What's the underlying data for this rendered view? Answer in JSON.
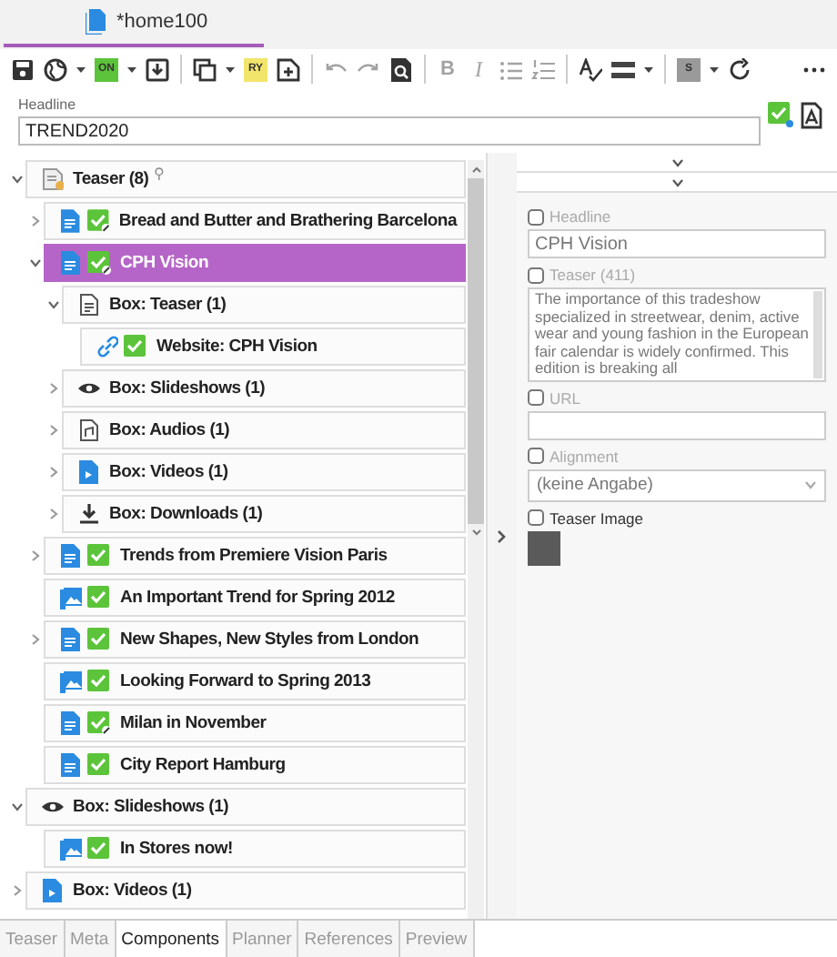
{
  "document_tab": {
    "title": "*home100",
    "selected": true
  },
  "toolbar": [
    {
      "kind": "save"
    },
    {
      "kind": "globe",
      "caret": true
    },
    {
      "kind": "badge",
      "label": "ON",
      "color": "#5cc43a",
      "caret": true
    },
    {
      "kind": "import"
    },
    {
      "kind": "separator"
    },
    {
      "kind": "copy",
      "caret": true
    },
    {
      "kind": "badge",
      "label": "RY",
      "color": "#f2e56b"
    },
    {
      "kind": "add-doc"
    },
    {
      "kind": "separator"
    },
    {
      "kind": "undo",
      "disabled": true
    },
    {
      "kind": "redo",
      "disabled": true
    },
    {
      "kind": "preview"
    },
    {
      "kind": "separator"
    },
    {
      "kind": "text",
      "label": "B",
      "disabled": true
    },
    {
      "kind": "text",
      "label": "I",
      "disabled": true,
      "italic": true
    },
    {
      "kind": "bullets",
      "disabled": true
    },
    {
      "kind": "numbers",
      "disabled": true
    },
    {
      "kind": "separator"
    },
    {
      "kind": "spell"
    },
    {
      "kind": "rule",
      "caret": true
    },
    {
      "kind": "separator"
    },
    {
      "kind": "badge",
      "label": "S",
      "color": "#9a9a9a",
      "caret": true
    },
    {
      "kind": "refresh"
    },
    {
      "kind": "more"
    }
  ],
  "headline": {
    "label": "Headline",
    "value": "TREND2020"
  },
  "tree": [
    {
      "label": "Teaser (8)",
      "kind": "teaser",
      "pin": "⚲",
      "expanded": true,
      "selected": false,
      "children": [
        {
          "label": "Bread and Butter and Brathering Barcelona",
          "kind": "article",
          "approved": true,
          "edited": true,
          "expanded": false,
          "selected": false
        },
        {
          "label": "CPH Vision",
          "kind": "article",
          "approved": true,
          "edited": true,
          "expanded": true,
          "selected": true,
          "children": [
            {
              "label": "Box: Teaser (1)",
              "kind": "box",
              "expanded": true,
              "selected": false,
              "children": [
                {
                  "label": "Website: CPH Vision",
                  "kind": "link",
                  "approved": true,
                  "edited": false,
                  "selected": false
                }
              ]
            },
            {
              "label": "Box: Slideshows (1)",
              "kind": "slideshow",
              "expanded": false,
              "selected": false
            },
            {
              "label": "Box: Audios (1)",
              "kind": "audio",
              "expanded": false,
              "selected": false
            },
            {
              "label": "Box: Videos (1)",
              "kind": "video",
              "expanded": false,
              "selected": false
            },
            {
              "label": "Box: Downloads (1)",
              "kind": "download",
              "expanded": false,
              "selected": false
            }
          ]
        },
        {
          "label": "Trends from Premiere Vision Paris",
          "kind": "article",
          "approved": true,
          "edited": false,
          "expanded": false,
          "selected": false
        },
        {
          "label": "An Important Trend for Spring 2012",
          "kind": "gallery",
          "approved": true,
          "edited": false,
          "selected": false
        },
        {
          "label": "New Shapes, New Styles from London",
          "kind": "article",
          "approved": true,
          "edited": false,
          "expanded": false,
          "selected": false
        },
        {
          "label": "Looking Forward to Spring 2013",
          "kind": "gallery",
          "approved": true,
          "edited": false,
          "selected": false
        },
        {
          "label": "Milan in November",
          "kind": "article",
          "approved": true,
          "edited": true,
          "selected": false
        },
        {
          "label": "City Report Hamburg",
          "kind": "article",
          "approved": true,
          "edited": false,
          "selected": false
        }
      ]
    },
    {
      "label": "Box: Slideshows (1)",
      "kind": "slideshow",
      "expanded": true,
      "selected": false,
      "children": [
        {
          "label": "In Stores now!",
          "kind": "gallery",
          "approved": true,
          "edited": false,
          "selected": false
        }
      ]
    },
    {
      "label": "Box: Videos (1)",
      "kind": "video",
      "expanded": false,
      "selected": false
    }
  ],
  "properties": [
    {
      "kind": "text",
      "label": "Headline",
      "checked": false,
      "disabled": true,
      "value": "CPH Vision"
    },
    {
      "kind": "textarea",
      "label": "Teaser (411)",
      "checked": false,
      "disabled": true,
      "value": "The importance of this tradeshow specialized in streetwear, denim, active wear and young fashion in the European fair calendar is widely confirmed. This edition is breaking all"
    },
    {
      "kind": "text",
      "label": "URL",
      "checked": false,
      "disabled": true
    },
    {
      "kind": "select",
      "label": "Alignment",
      "checked": false,
      "disabled": true,
      "value": "(keine Angabe)"
    },
    {
      "kind": "image",
      "label": "Teaser Image",
      "checked": false,
      "disabled": false
    }
  ],
  "bottom_tabs": [
    {
      "label": "Teaser",
      "selected": false
    },
    {
      "label": "Meta",
      "selected": false
    },
    {
      "label": "Components",
      "selected": true
    },
    {
      "label": "Planner",
      "selected": false
    },
    {
      "label": "References",
      "selected": false
    },
    {
      "label": "Preview",
      "selected": false
    }
  ]
}
